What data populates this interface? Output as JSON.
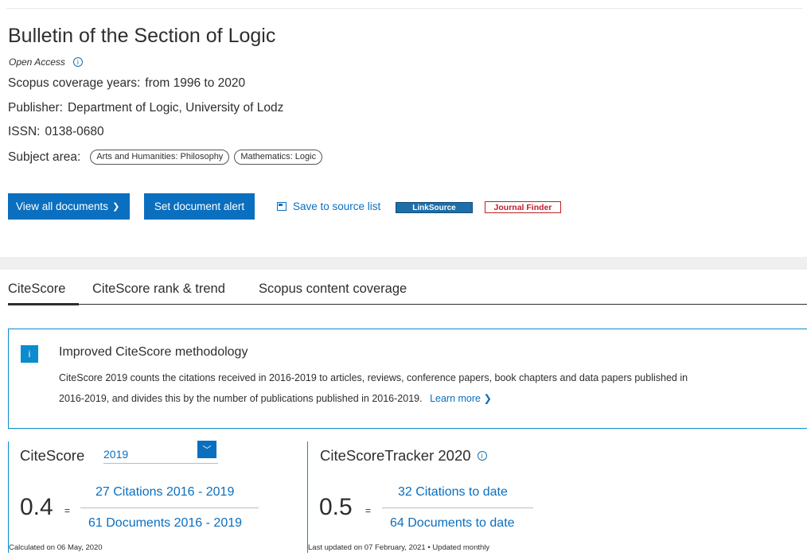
{
  "journal": {
    "title": "Bulletin of the Section of Logic",
    "open_access": "Open Access",
    "coverage_label": "Scopus coverage years:",
    "coverage_value": "from 1996 to 2020",
    "publisher_label": "Publisher:",
    "publisher_value": "Department of Logic, University of Lodz",
    "issn_label": "ISSN:",
    "issn_value": "0138-0680",
    "subject_label": "Subject area:",
    "subjects": [
      "Arts and Humanities: Philosophy",
      "Mathematics: Logic"
    ]
  },
  "actions": {
    "view_all": "View all documents",
    "view_all_chevron": "❯",
    "set_alert": "Set document alert",
    "save_to_list": "Save to source list",
    "linksource": "LinkSource",
    "journal_finder": "Journal Finder"
  },
  "tabs": [
    "CiteScore",
    "CiteScore rank & trend",
    "Scopus content coverage"
  ],
  "notice": {
    "icon": "i",
    "title": "Improved CiteScore methodology",
    "body": "CiteScore 2019 counts the citations received in 2016-2019 to articles, reviews, conference papers, book chapters and data papers published in 2016-2019, and divides this by the number of publications published in 2016-2019.",
    "learn_more": "Learn more ❯"
  },
  "citescore": {
    "label": "CiteScore",
    "year": "2019",
    "value": "0.4",
    "equals": "=",
    "numerator": "27 Citations 2016 - 2019",
    "denominator": "61 Documents 2016 - 2019",
    "calculated": "Calculated on 06 May, 2020"
  },
  "tracker": {
    "label": "CiteScoreTracker 2020",
    "value": "0.5",
    "equals": "=",
    "numerator": "32 Citations to date",
    "denominator": "64 Documents to date",
    "updated": "Last updated on 07 February, 2021 • Updated monthly"
  },
  "colors": {
    "accent": "#0a6fbf",
    "info": "#0a8ccf",
    "journal_finder": "#c0202a"
  }
}
